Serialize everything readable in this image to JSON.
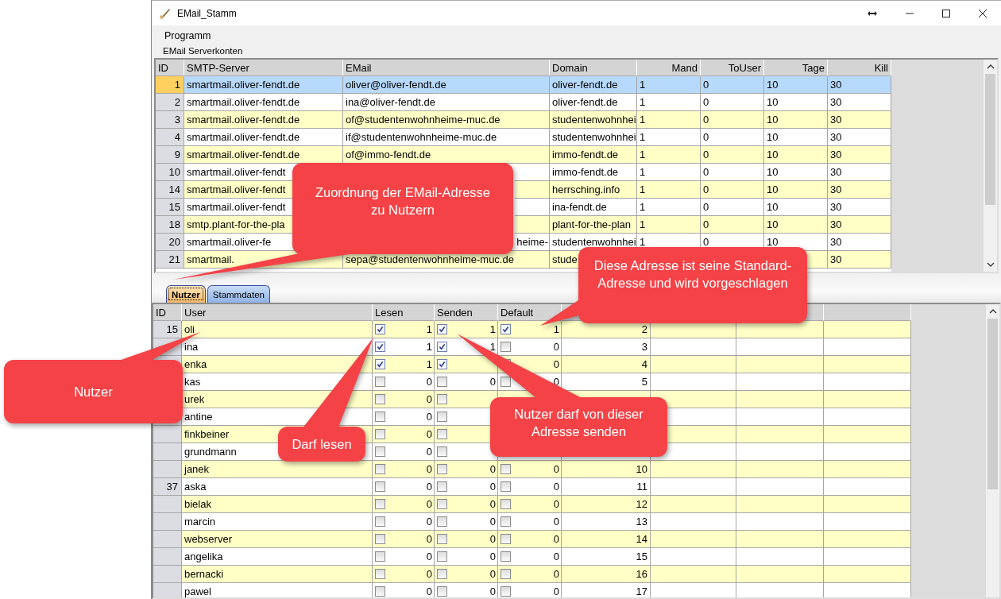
{
  "window": {
    "title": "EMail_Stamm"
  },
  "menu": [
    "Programm"
  ],
  "server_accounts": {
    "title": "EMail Serverkonten",
    "columns": [
      {
        "label": "ID"
      },
      {
        "label": "SMTP-Server"
      },
      {
        "label": "EMail"
      },
      {
        "label": "Domain"
      },
      {
        "label": "Mand"
      },
      {
        "label": "ToUser"
      },
      {
        "label": "Tage"
      },
      {
        "label": "Kill"
      }
    ],
    "rows": [
      {
        "id": "1",
        "smtp_server": "smartmail.oliver-fendt.de",
        "email": "oliver@oliver-fendt.de",
        "domain": "oliver-fendt.de",
        "mand": "1",
        "to_user": "0",
        "tage": "10",
        "kill": "30",
        "selected": true
      },
      {
        "id": "2",
        "smtp_server": "smartmail.oliver-fendt.de",
        "email": "ina@oliver-fendt.de",
        "domain": "oliver-fendt.de",
        "mand": "1",
        "to_user": "0",
        "tage": "10",
        "kill": "30",
        "selected": false
      },
      {
        "id": "3",
        "smtp_server": "smartmail.oliver-fendt.de",
        "email": "of@studentenwohnheime-muc.de",
        "domain": "studentenwohnhei",
        "mand": "1",
        "to_user": "0",
        "tage": "10",
        "kill": "30",
        "selected": false
      },
      {
        "id": "4",
        "smtp_server": "smartmail.oliver-fendt.de",
        "email": "if@studentenwohnheime-muc.de",
        "domain": "studentenwohnhei",
        "mand": "1",
        "to_user": "0",
        "tage": "10",
        "kill": "30",
        "selected": false
      },
      {
        "id": "9",
        "smtp_server": "smartmail.oliver-fendt.de",
        "email": "of@immo-fendt.de",
        "domain": "immo-fendt.de",
        "mand": "1",
        "to_user": "0",
        "tage": "10",
        "kill": "30",
        "selected": false
      },
      {
        "id": "10",
        "smtp_server": "smartmail.oliver-fendt",
        "domain": "immo-fendt.de",
        "mand": "1",
        "to_user": "0",
        "tage": "10",
        "kill": "30",
        "selected": false
      },
      {
        "id": "14",
        "smtp_server": "smartmail.oliver-fendt",
        "domain": "herrsching.info",
        "mand": "1",
        "to_user": "0",
        "tage": "10",
        "kill": "30",
        "selected": false
      },
      {
        "id": "15",
        "smtp_server": "smartmail.oliver-fendt",
        "domain": "ina-fendt.de",
        "mand": "1",
        "to_user": "0",
        "tage": "10",
        "kill": "30",
        "selected": false
      },
      {
        "id": "18",
        "smtp_server": "smtp.plant-for-the-pla",
        "domain": "plant-for-the-plan",
        "mand": "1",
        "to_user": "0",
        "tage": "10",
        "kill": "30",
        "selected": false
      },
      {
        "id": "20",
        "smtp_server": "smartmail.oliver-fe",
        "email_tail": "heime-",
        "domain": "studentenwohnhei",
        "mand": "1",
        "to_user": "0",
        "tage": "10",
        "kill": "30",
        "selected": false
      },
      {
        "id": "21",
        "smtp_server": "smartmail.",
        "email": "sepa@studentenwohnheime-muc.de",
        "domain": "stude",
        "kill": "30",
        "selected": false
      }
    ]
  },
  "tabs": [
    {
      "label": "Nutzer",
      "selected": true
    },
    {
      "label": "Stammdaten",
      "selected": false
    }
  ],
  "users": {
    "columns": [
      {
        "label": "ID"
      },
      {
        "label": "User"
      },
      {
        "label": "Lesen"
      },
      {
        "label": "Senden"
      },
      {
        "label": "Default"
      }
    ],
    "rows": [
      {
        "id": "15",
        "user": "oli",
        "lesen": {
          "checked": true,
          "value": "1"
        },
        "senden": {
          "checked": true,
          "value": "1"
        },
        "default": {
          "checked": true,
          "value": "1"
        },
        "column_6": "2"
      },
      {
        "user": "ina",
        "lesen": {
          "checked": true,
          "value": "1"
        },
        "senden": {
          "checked": true,
          "value": "1"
        },
        "default": {
          "checked": false,
          "value": "0"
        },
        "column_6": "3"
      },
      {
        "user": "enka",
        "lesen": {
          "checked": true,
          "value": "1"
        },
        "senden": {
          "checked": true
        },
        "default": {
          "checked": false,
          "value": "0"
        },
        "column_6": "4"
      },
      {
        "user": "kas",
        "lesen": {
          "checked": false,
          "value": "0"
        },
        "senden": {
          "checked": false,
          "value": "0"
        },
        "default": {
          "checked": false,
          "value": "0"
        },
        "column_6": "5"
      },
      {
        "user": "urek",
        "lesen": {
          "checked": false,
          "value": "0"
        },
        "senden": {
          "checked": false
        }
      },
      {
        "user": "antine",
        "lesen": {
          "checked": false,
          "value": "0"
        },
        "senden": {
          "checked": false
        }
      },
      {
        "user": "finkbeiner",
        "lesen": {
          "checked": false,
          "value": "0"
        },
        "senden": {
          "checked": false
        }
      },
      {
        "user": "grundmann",
        "lesen": {
          "checked": false,
          "value": "0"
        },
        "senden": {
          "checked": false
        }
      },
      {
        "user": "janek",
        "lesen": {
          "checked": false,
          "value": "0"
        },
        "senden": {
          "checked": false,
          "value": "0"
        },
        "default": {
          "checked": false,
          "value": "0"
        },
        "column_6": "10"
      },
      {
        "id": "37",
        "user": "aska",
        "lesen": {
          "checked": false,
          "value": "0"
        },
        "senden": {
          "checked": false,
          "value": "0"
        },
        "default": {
          "checked": false,
          "value": "0"
        },
        "column_6": "11"
      },
      {
        "user": "bielak",
        "lesen": {
          "checked": false,
          "value": "0"
        },
        "senden": {
          "checked": false,
          "value": "0"
        },
        "default": {
          "checked": false,
          "value": "0"
        },
        "column_6": "12"
      },
      {
        "user": "marcin",
        "lesen": {
          "checked": false,
          "value": "0"
        },
        "senden": {
          "checked": false,
          "value": "0"
        },
        "default": {
          "checked": false,
          "value": "0"
        },
        "column_6": "13"
      },
      {
        "user": "webserver",
        "lesen": {
          "checked": false,
          "value": "0"
        },
        "senden": {
          "checked": false,
          "value": "0"
        },
        "default": {
          "checked": false,
          "value": "0"
        },
        "column_6": "14"
      },
      {
        "user": "angelika",
        "lesen": {
          "checked": false,
          "value": "0"
        },
        "senden": {
          "checked": false,
          "value": "0"
        },
        "default": {
          "checked": false,
          "value": "0"
        },
        "column_6": "15"
      },
      {
        "user": "bernacki",
        "lesen": {
          "checked": false,
          "value": "0"
        },
        "senden": {
          "checked": false,
          "value": "0"
        },
        "default": {
          "checked": false,
          "value": "0"
        },
        "column_6": "16"
      },
      {
        "user": "pawel",
        "lesen": {
          "checked": false,
          "value": "0"
        },
        "senden": {
          "checked": false,
          "value": "0"
        },
        "default": {
          "checked": false,
          "value": "0"
        },
        "column_6": "17"
      }
    ]
  },
  "callouts": [
    {
      "text": "Zuordnung der EMail-Adresse zu Nutzern"
    },
    {
      "text": "Diese Adresse ist seine Standard-Adresse und wird vorgeschlagen"
    },
    {
      "text": "Nutzer"
    },
    {
      "text": "Nutzer darf von dieser Adresse senden"
    },
    {
      "text": "Darf lesen"
    }
  ]
}
